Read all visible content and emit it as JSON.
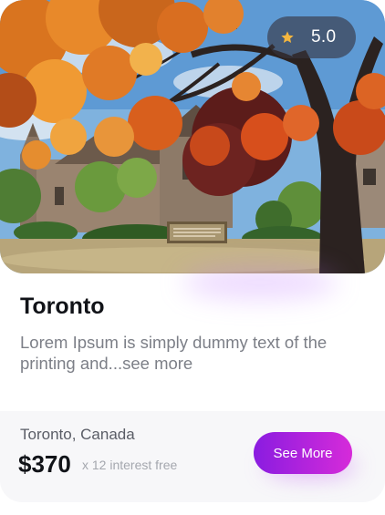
{
  "card": {
    "rating": {
      "icon": "star-icon",
      "value": "5.0"
    },
    "title": "Toronto",
    "description": "Lorem Ipsum is simply dummy text of the printing and...",
    "see_more_link": "see more",
    "location": "Toronto, Canada",
    "price": "$370",
    "interest_note": "x 12 interest free",
    "button_label": "See More"
  },
  "colors": {
    "accent_start": "#8a1ce0",
    "accent_end": "#d62bd9",
    "star": "#f4b63f",
    "title": "#111318",
    "muted_text": "#7c7f87"
  }
}
